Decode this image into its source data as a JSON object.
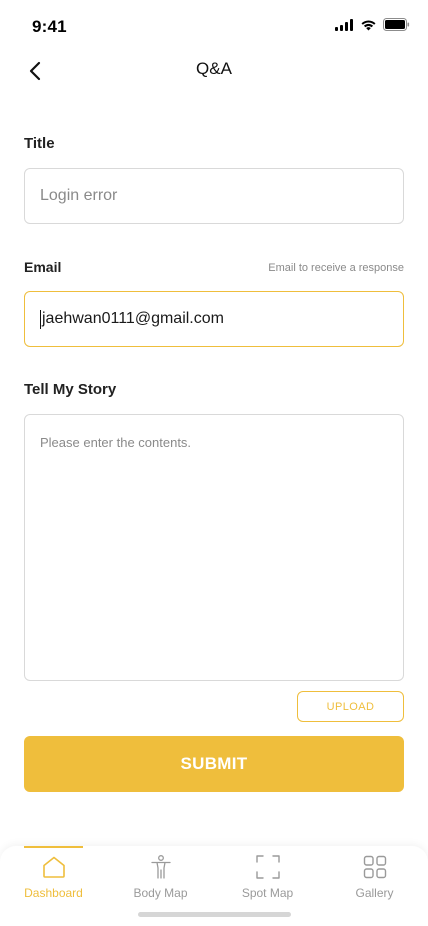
{
  "status_bar": {
    "time": "9:41"
  },
  "header": {
    "title": "Q&A"
  },
  "form": {
    "title_label": "Title",
    "title_value": "Login error",
    "email_label": "Email",
    "email_hint": "Email to receive a response",
    "email_value": "jaehwan0111@gmail.com",
    "story_label": "Tell My Story",
    "story_placeholder": "Please enter the contents.",
    "upload_label": "UPLOAD",
    "submit_label": "SUBMIT"
  },
  "tab_bar": {
    "items": [
      {
        "label": "Dashboard",
        "icon": "home-icon",
        "active": true
      },
      {
        "label": "Body Map",
        "icon": "body-icon",
        "active": false
      },
      {
        "label": "Spot Map",
        "icon": "scan-frame-icon",
        "active": false
      },
      {
        "label": "Gallery",
        "icon": "grid-icon",
        "active": false
      }
    ]
  },
  "colors": {
    "accent": "#efbe3c",
    "border": "#d9d9d9",
    "muted_text": "#8a8a8a",
    "inactive_tab": "#9a9a9a"
  }
}
